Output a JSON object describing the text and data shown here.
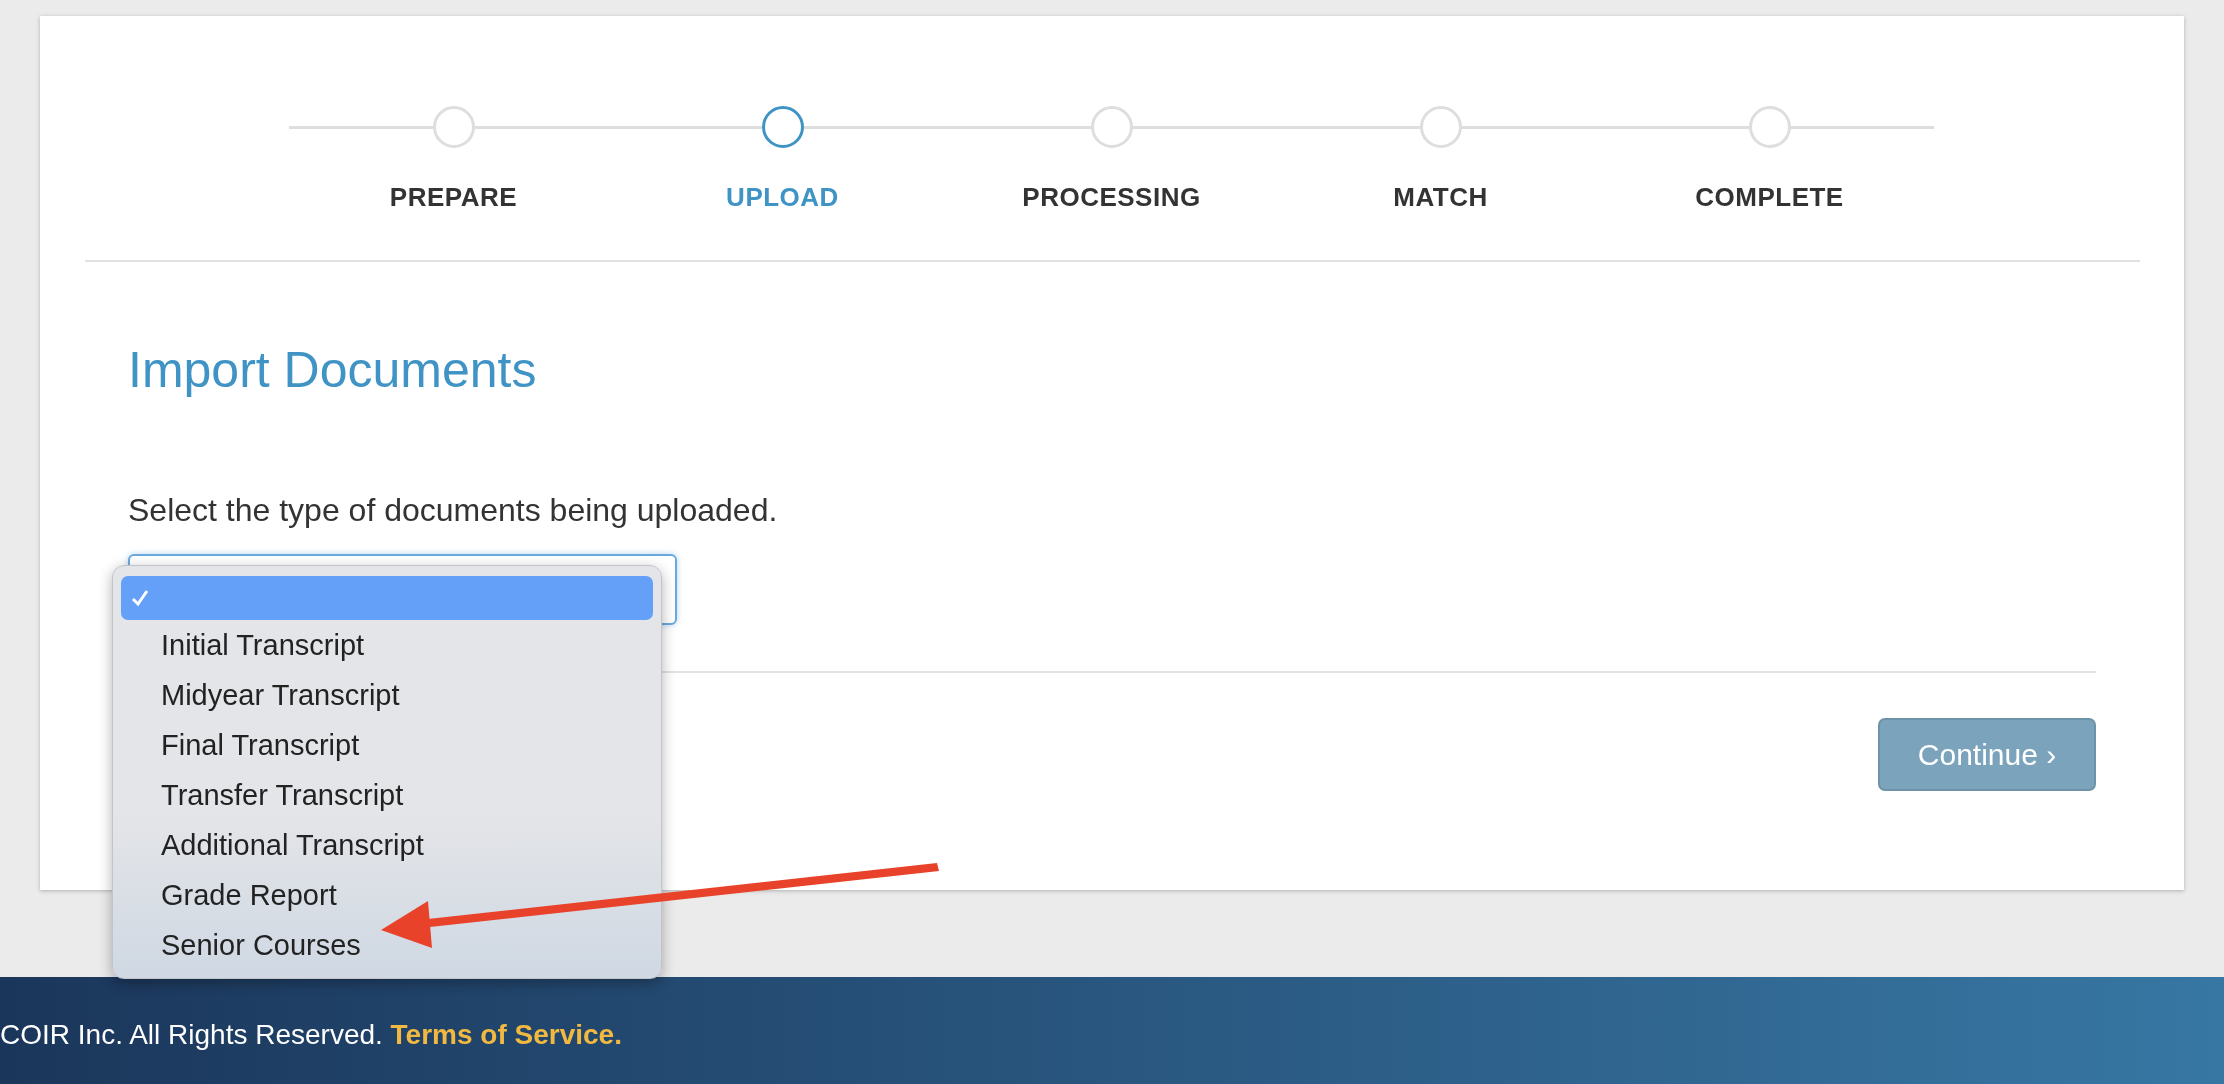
{
  "steps": [
    {
      "label": "PREPARE",
      "selected": false
    },
    {
      "label": "UPLOAD",
      "selected": true
    },
    {
      "label": "PROCESSING",
      "selected": false
    },
    {
      "label": "MATCH",
      "selected": false
    },
    {
      "label": "COMPLETE",
      "selected": false
    }
  ],
  "heading": "Import Documents",
  "instruction": "Select the type of documents being uploaded.",
  "document_type_menu": {
    "blank_option": {
      "selected": true,
      "checked": true
    },
    "options": [
      {
        "label": "Initial Transcript",
        "selected": false
      },
      {
        "label": "Midyear Transcript",
        "selected": false
      },
      {
        "label": "Final Transcript",
        "selected": false
      },
      {
        "label": "Transfer Transcript",
        "selected": false
      },
      {
        "label": "Additional Transcript",
        "selected": false
      },
      {
        "label": "Grade Report",
        "selected": false
      },
      {
        "label": "Senior Courses",
        "selected": false
      }
    ]
  },
  "continue_button": {
    "label": "Continue ›",
    "disabled": true
  },
  "footer": {
    "text": "COIR Inc. All Rights Reserved.",
    "link": "Terms of Service."
  }
}
